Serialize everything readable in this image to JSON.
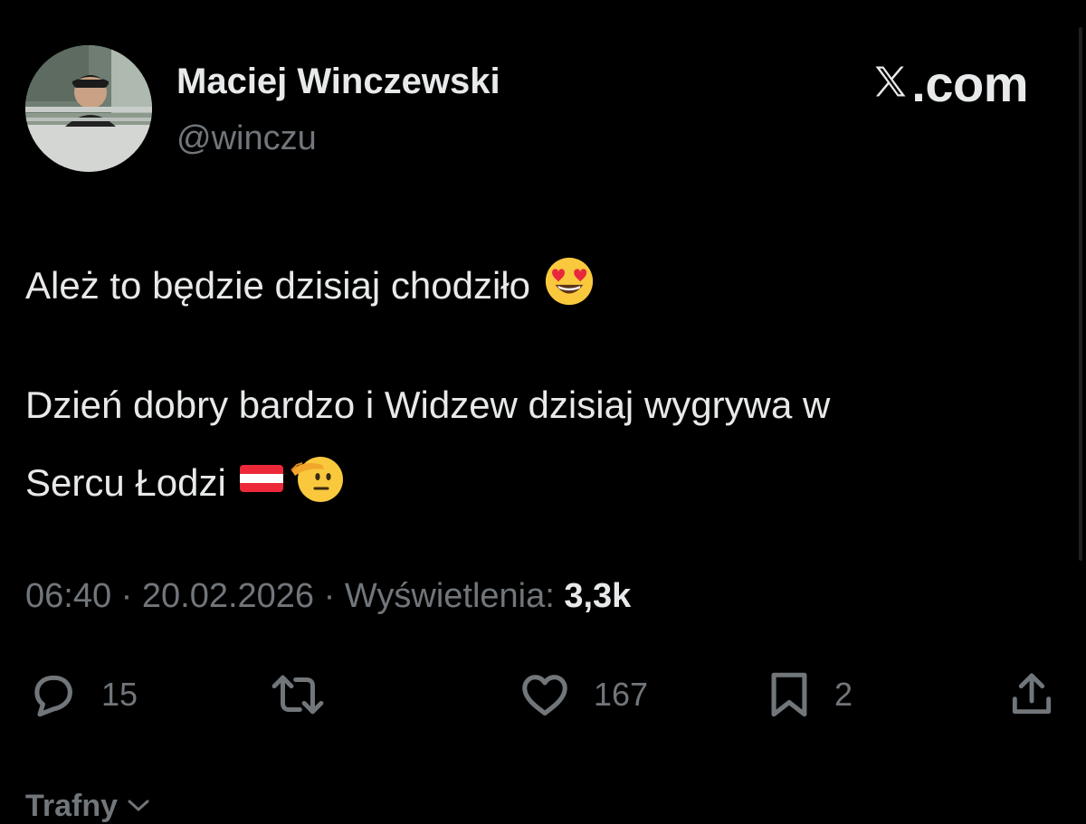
{
  "author": {
    "display_name": "Maciej Winczewski",
    "handle": "@winczu",
    "avatar_icon": "profile-photo"
  },
  "site": {
    "label": ".com",
    "logo_icon": "x-logo-icon"
  },
  "tweet": {
    "line1": "Ależ to będzie dzisiaj chodziło",
    "line1_emoji": "heart-eyes-emoji",
    "line2": "Dzień dobry bardzo i Widzew dzisiaj wygrywa w",
    "line3": "Sercu Łodzi",
    "line3_emojis": [
      "red-white-red-flag-emoji",
      "saluting-face-emoji"
    ]
  },
  "meta": {
    "time": "06:40",
    "separator": " · ",
    "date": "20.02.2026",
    "views_label": "Wyświetlenia:",
    "views_value": "3,3k"
  },
  "actions": {
    "reply": {
      "icon": "reply-icon",
      "count": "15"
    },
    "retweet": {
      "icon": "retweet-icon"
    },
    "like": {
      "icon": "heart-icon",
      "count": "167"
    },
    "bookmark": {
      "icon": "bookmark-icon",
      "count": "2"
    },
    "share": {
      "icon": "share-icon"
    }
  },
  "replies_sort": {
    "label": "Trafny",
    "icon": "chevron-down-icon"
  },
  "colors": {
    "background": "#000000",
    "primary_text": "#e7e9ea",
    "secondary_text": "#71767b"
  }
}
